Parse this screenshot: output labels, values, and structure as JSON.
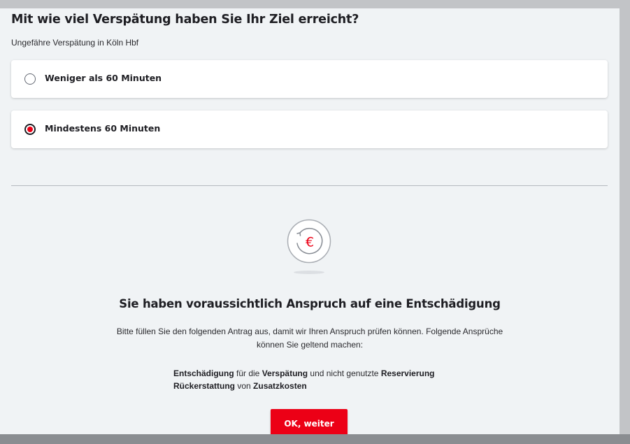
{
  "question": {
    "title": "Mit wie viel Verspätung haben Sie Ihr Ziel erreicht?",
    "subtitle": "Ungefähre Verspätung in Köln Hbf"
  },
  "options": [
    {
      "label": "Weniger als 60 Minuten",
      "selected": false
    },
    {
      "label": "Mindestens 60 Minuten",
      "selected": true
    }
  ],
  "result": {
    "icon": "euro-refund-icon",
    "title": "Sie haben voraussichtlich Anspruch auf eine Entschädigung",
    "description": "Bitte füllen Sie den folgenden Antrag aus, damit wir Ihren Anspruch prüfen können. Folgende Ansprüche können Sie geltend machen:",
    "claims": [
      {
        "w1": "Entschädigung",
        "t1": " für die ",
        "w2": "Verspätung",
        "t2": " und nicht genutzte ",
        "w3": "Reservierung"
      },
      {
        "w1": "Rückerstattung",
        "t1": " von ",
        "w2": "Zusatzkosten"
      }
    ]
  },
  "buttons": {
    "ok_label": "OK, weiter"
  },
  "colors": {
    "accent": "#ec0016",
    "background": "#f0f3f5",
    "text": "#1e1e23"
  }
}
